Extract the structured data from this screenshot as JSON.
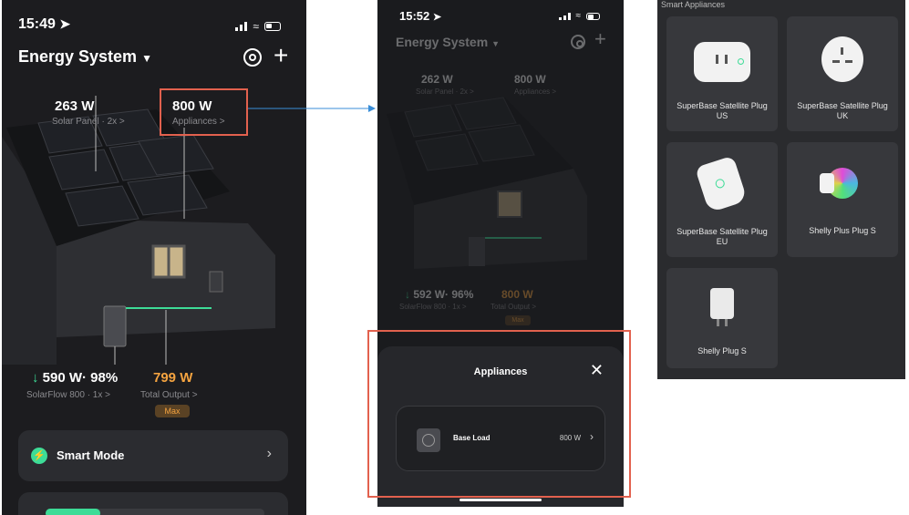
{
  "screen1": {
    "time": "15:49",
    "title": "Energy System",
    "solar_value": "263 W",
    "solar_label": "Solar Panel · 2x >",
    "appliances_value": "800 W",
    "appliances_label": "Appliances >",
    "flow_value": "590 W· 98%",
    "flow_label": "SolarFlow 800 · 1x >",
    "output_value": "799 W",
    "output_label": "Total Output >",
    "output_badge": "Max",
    "smart_mode_label": "Smart Mode"
  },
  "screen2": {
    "time": "15:52",
    "title": "Energy System",
    "solar_value": "262 W",
    "solar_label": "Solar Panel · 2x >",
    "appliances_value": "800 W",
    "appliances_label": "Appliances >",
    "flow_value": "592 W· 96%",
    "flow_label": "SolarFlow 800 · 1x >",
    "output_value": "800 W",
    "output_label": "Total Output >",
    "output_badge": "Max",
    "sheet_title": "Appliances",
    "base_load_name": "Base Load",
    "base_load_value": "800 W"
  },
  "appliance_list": {
    "header": "Smart Appliances",
    "items": [
      "SuperBase Satellite Plug US",
      "SuperBase Satellite Plug UK",
      "SuperBase Satellite Plug EU",
      "Shelly Plus Plug S",
      "Shelly Plug S"
    ]
  },
  "colors": {
    "highlight": "#e2614e",
    "arrow": "#3a8ed8",
    "accent_green": "#3ddc97",
    "accent_orange": "#f4a340"
  }
}
